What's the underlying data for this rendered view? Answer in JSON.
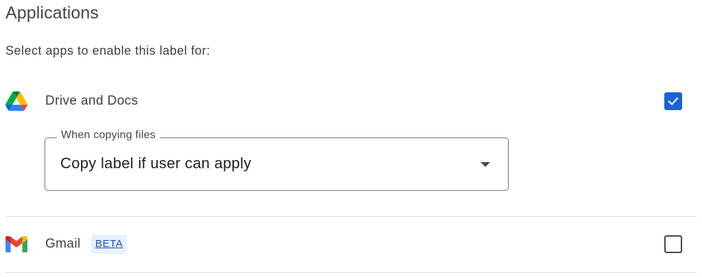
{
  "section": {
    "title": "Applications",
    "subtitle": "Select apps to enable this label for:"
  },
  "apps": [
    {
      "name": "Drive and Docs",
      "icon": "google-drive-icon",
      "enabled": true,
      "option": {
        "label": "When copying files",
        "value": "Copy label if user can apply"
      }
    },
    {
      "name": "Gmail",
      "icon": "gmail-icon",
      "badge": "BETA",
      "enabled": false
    }
  ],
  "colors": {
    "checkbox_checked": "#1a62d6",
    "badge_bg": "#e8f0fe",
    "badge_text": "#1a4fbf",
    "divider": "#dadce0"
  }
}
